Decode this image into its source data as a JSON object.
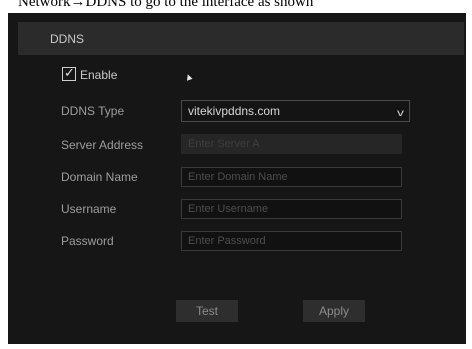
{
  "caption": "Network→DDNS to go to the interface as shown",
  "panel": {
    "title": "DDNS"
  },
  "enable": {
    "label": "Enable",
    "checked": true
  },
  "form": {
    "ddns_type_label": "DDNS Type",
    "ddns_type_value": "vitekivpddns.com",
    "server_address_label": "Server Address",
    "server_address_placeholder": "Enter Server A",
    "domain_name_label": "Domain Name",
    "domain_name_placeholder": "Enter Domain Name",
    "username_label": "Username",
    "username_placeholder": "Enter Username",
    "password_label": "Password",
    "password_placeholder": "Enter Password"
  },
  "buttons": {
    "test_label": "Test",
    "apply_label": "Apply"
  },
  "icons": {
    "checkbox": "checkmark-icon",
    "dropdown": "chevron-down-icon",
    "cursor": "mouse-pointer-icon"
  }
}
